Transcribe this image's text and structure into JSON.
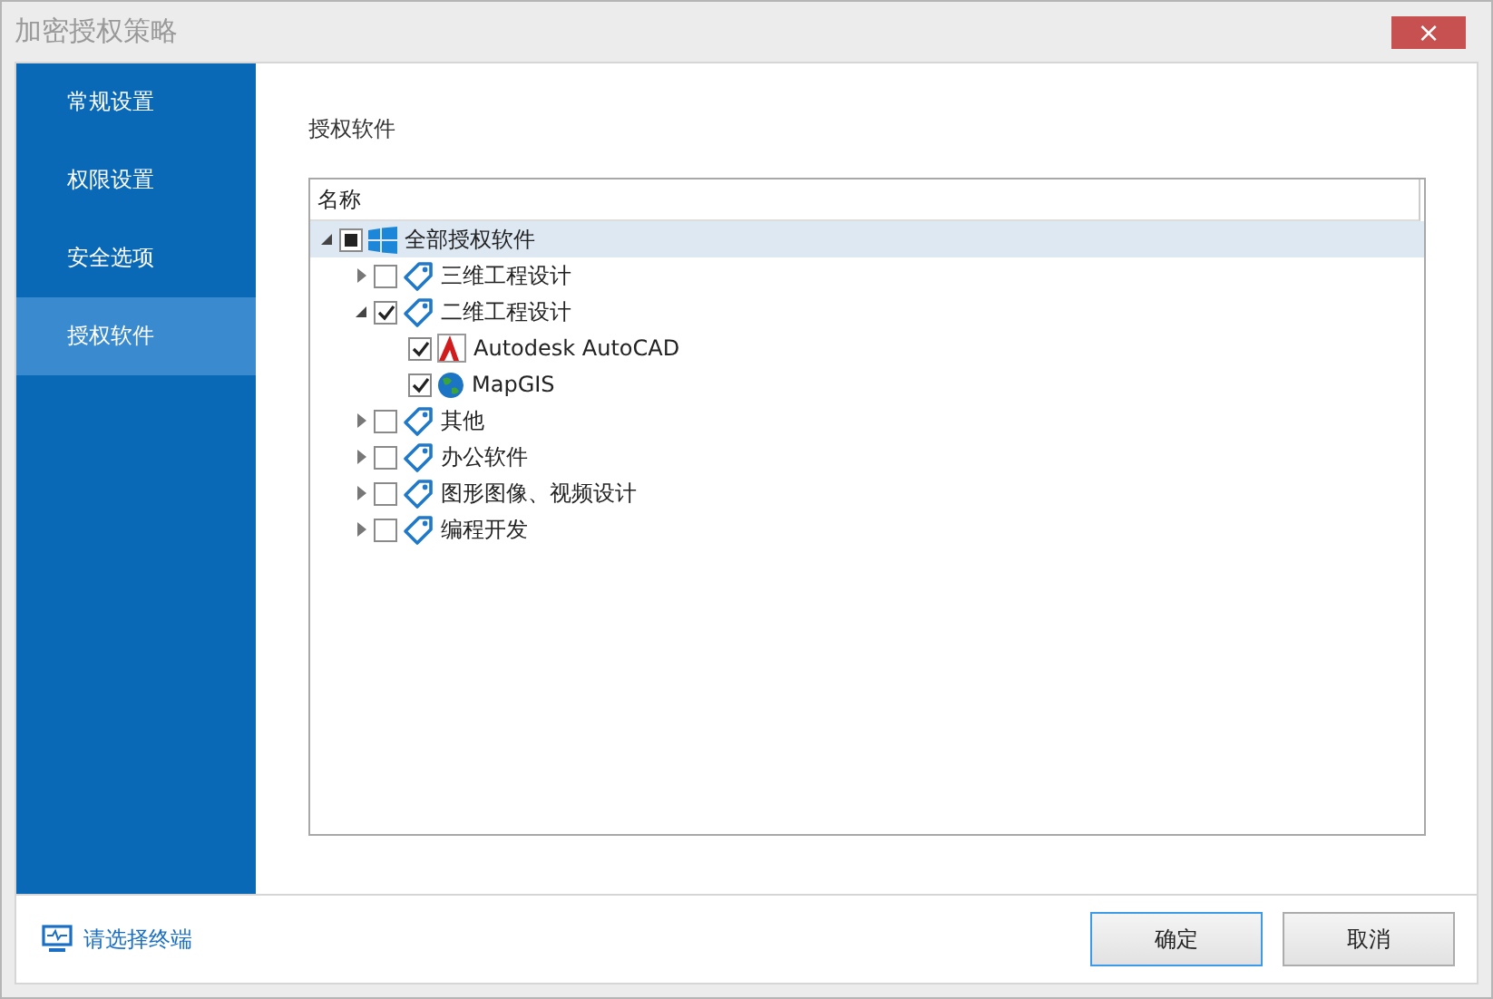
{
  "window": {
    "title": "加密授权策略",
    "close": "×"
  },
  "sidebar": {
    "items": [
      {
        "label": "常规设置",
        "selected": false
      },
      {
        "label": "权限设置",
        "selected": false
      },
      {
        "label": "安全选项",
        "selected": false
      },
      {
        "label": "授权软件",
        "selected": true
      }
    ]
  },
  "section_title": "授权软件",
  "tree": {
    "column": "名称",
    "nodes": [
      {
        "label": "全部授权软件",
        "kind": "windows",
        "indeterminate": true,
        "expanded": true,
        "selected": true,
        "children": [
          {
            "label": "三维工程设计",
            "kind": "tag",
            "checked": false,
            "expanded": false,
            "selected": false
          },
          {
            "label": "二维工程设计",
            "kind": "tag",
            "checked": true,
            "expanded": true,
            "selected": false,
            "children": [
              {
                "label": "Autodesk AutoCAD",
                "kind": "autocad",
                "checked": true,
                "selected": false
              },
              {
                "label": "MapGIS",
                "kind": "globe",
                "checked": true,
                "selected": false
              }
            ]
          },
          {
            "label": "其他",
            "kind": "tag",
            "checked": false,
            "expanded": false,
            "selected": false
          },
          {
            "label": "办公软件",
            "kind": "tag",
            "checked": false,
            "expanded": false,
            "selected": false
          },
          {
            "label": "图形图像、视频设计",
            "kind": "tag",
            "checked": false,
            "expanded": false,
            "selected": false
          },
          {
            "label": "编程开发",
            "kind": "tag",
            "checked": false,
            "expanded": false,
            "selected": false
          }
        ]
      }
    ]
  },
  "footer": {
    "link": "请选择终端",
    "buttons": [
      {
        "label": "确定",
        "primary": true
      },
      {
        "label": "取消",
        "primary": false
      }
    ]
  }
}
